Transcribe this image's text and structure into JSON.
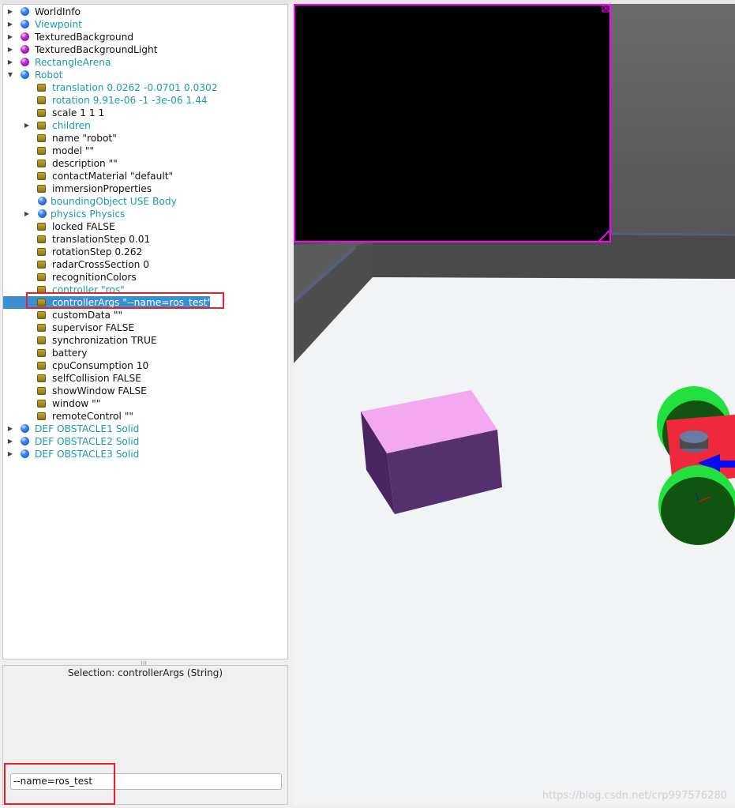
{
  "scene_tree": {
    "items": [
      {
        "label": "WorldInfo",
        "level": 0,
        "icon": "blue-sphere",
        "expander": "collapsed",
        "teal": false
      },
      {
        "label": "Viewpoint",
        "level": 0,
        "icon": "blue-sphere",
        "expander": "collapsed",
        "teal": true
      },
      {
        "label": "TexturedBackground",
        "level": 0,
        "icon": "purple-sphere",
        "expander": "collapsed",
        "teal": false
      },
      {
        "label": "TexturedBackgroundLight",
        "level": 0,
        "icon": "purple-sphere",
        "expander": "collapsed",
        "teal": false
      },
      {
        "label": "RectangleArena",
        "level": 0,
        "icon": "purple-sphere",
        "expander": "collapsed",
        "teal": true
      },
      {
        "label": "Robot",
        "level": 0,
        "icon": "blue-sphere",
        "expander": "expanded",
        "teal": true
      },
      {
        "label": "translation 0.0262 -0.0701 0.0302",
        "level": 1,
        "icon": "field-cylinder",
        "teal": true
      },
      {
        "label": "rotation 9.91e-06 -1 -3e-06 1.44",
        "level": 1,
        "icon": "field-cylinder",
        "teal": true
      },
      {
        "label": "scale 1 1 1",
        "level": 1,
        "icon": "field-cylinder",
        "teal": false
      },
      {
        "label": "children",
        "level": 1,
        "icon": "field-cylinder",
        "expander": "collapsed",
        "teal": true
      },
      {
        "label": "name \"robot\"",
        "level": 1,
        "icon": "field-cylinder",
        "teal": false
      },
      {
        "label": "model \"\"",
        "level": 1,
        "icon": "field-cylinder",
        "teal": false
      },
      {
        "label": "description \"\"",
        "level": 1,
        "icon": "field-cylinder",
        "teal": false
      },
      {
        "label": "contactMaterial \"default\"",
        "level": 1,
        "icon": "field-cylinder",
        "teal": false
      },
      {
        "label": "immersionProperties",
        "level": 1,
        "icon": "field-cylinder",
        "teal": false
      },
      {
        "label": "boundingObject USE Body",
        "level": 1,
        "icon": "blue-sphere",
        "teal": true
      },
      {
        "label": "physics Physics",
        "level": 1,
        "icon": "blue-sphere",
        "expander": "collapsed",
        "teal": true
      },
      {
        "label": "locked FALSE",
        "level": 1,
        "icon": "field-cylinder",
        "teal": false
      },
      {
        "label": "translationStep 0.01",
        "level": 1,
        "icon": "field-cylinder",
        "teal": false
      },
      {
        "label": "rotationStep 0.262",
        "level": 1,
        "icon": "field-cylinder",
        "teal": false
      },
      {
        "label": "radarCrossSection 0",
        "level": 1,
        "icon": "field-cylinder",
        "teal": false
      },
      {
        "label": "recognitionColors",
        "level": 1,
        "icon": "field-cylinder",
        "teal": false
      },
      {
        "label": "controller \"ros\"",
        "level": 1,
        "icon": "field-cylinder",
        "teal": true
      },
      {
        "label": "controllerArgs \"--name=ros_test\"",
        "level": 1,
        "icon": "field-cylinder",
        "teal": false,
        "selected": true
      },
      {
        "label": "customData \"\"",
        "level": 1,
        "icon": "field-cylinder",
        "teal": false
      },
      {
        "label": "supervisor FALSE",
        "level": 1,
        "icon": "field-cylinder",
        "teal": false
      },
      {
        "label": "synchronization TRUE",
        "level": 1,
        "icon": "field-cylinder",
        "teal": false
      },
      {
        "label": "battery",
        "level": 1,
        "icon": "field-cylinder",
        "teal": false
      },
      {
        "label": "cpuConsumption 10",
        "level": 1,
        "icon": "field-cylinder",
        "teal": false
      },
      {
        "label": "selfCollision FALSE",
        "level": 1,
        "icon": "field-cylinder",
        "teal": false
      },
      {
        "label": "showWindow FALSE",
        "level": 1,
        "icon": "field-cylinder",
        "teal": false
      },
      {
        "label": "window \"\"",
        "level": 1,
        "icon": "field-cylinder",
        "teal": false
      },
      {
        "label": "remoteControl \"\"",
        "level": 1,
        "icon": "field-cylinder",
        "teal": false
      },
      {
        "label": "DEF OBSTACLE1 Solid",
        "level": 0,
        "icon": "blue-sphere",
        "expander": "collapsed",
        "teal": true
      },
      {
        "label": "DEF OBSTACLE2 Solid",
        "level": 0,
        "icon": "blue-sphere",
        "expander": "collapsed",
        "teal": true
      },
      {
        "label": "DEF OBSTACLE3 Solid",
        "level": 0,
        "icon": "blue-sphere",
        "expander": "collapsed",
        "teal": true
      }
    ]
  },
  "field_editor": {
    "selection": "Selection: controllerArgs (String)",
    "value": "--name=ros_test"
  },
  "viewport": {
    "watermark": "https://blog.csdn.net/crp997576280",
    "colors": {
      "floor": "#f2f3f5",
      "wall": "#5e5e5e",
      "box_top": "#f2a9f0",
      "box_side": "#55306f",
      "robot_body": "#f0283c",
      "wheel": "#10540f",
      "overlay_border": "#ff00ff"
    }
  }
}
